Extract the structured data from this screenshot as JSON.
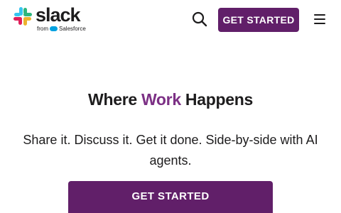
{
  "header": {
    "logo_text": "slack",
    "logo_subtext_prefix": "from",
    "logo_subtext_brand": "Salesforce",
    "search_icon": "search-icon",
    "cta_label": "GET STARTED",
    "menu_icon": "hamburger-menu-icon"
  },
  "hero": {
    "title_part1": "Where ",
    "title_accent": "Work",
    "title_part2": " Happens",
    "subtitle": "Share it. Discuss it. Get it done. Side-by-side with AI agents.",
    "cta_label": "GET STARTED"
  },
  "colors": {
    "brand_purple": "#611f69",
    "accent_purple": "#7c3085",
    "text": "#1d1c1d",
    "salesforce_blue": "#00a1e0"
  }
}
